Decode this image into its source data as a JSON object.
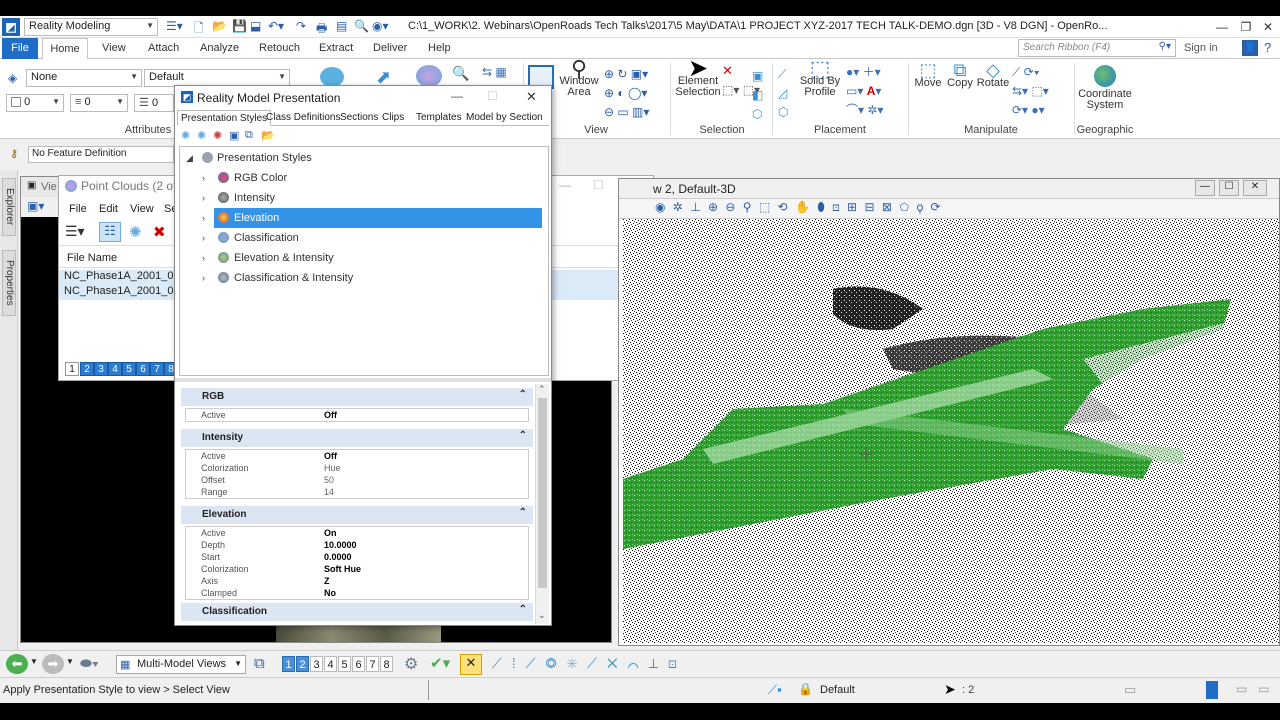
{
  "titlebar": {
    "workspace": "Reality Modeling",
    "title": "C:\\1_WORK\\2. Webinars\\OpenRoads Tech Talks\\2017\\5 May\\DATA\\1 PROJECT XYZ-2017 TECH TALK-DEMO.dgn [3D - V8 DGN] - OpenRo..."
  },
  "menu": {
    "file": "File",
    "tabs": [
      "Home",
      "View",
      "Attach",
      "Analyze",
      "Retouch",
      "Extract",
      "Deliver",
      "Help"
    ],
    "search_placeholder": "Search Ribbon (F4)",
    "sign_in": "Sign in"
  },
  "ribbon": {
    "level": "None",
    "style": "Default",
    "color": "0",
    "weight": "0",
    "linestyle": "0",
    "groups": {
      "attributes": "Attributes",
      "view": "View",
      "selection": "Selection",
      "placement": "Placement",
      "manipulate": "Manipulate",
      "geographic": "Geographic"
    },
    "buttons": {
      "window_area": "Window Area",
      "element_selection": "Element Selection",
      "solid_by_profile": "Solid By Profile",
      "move": "Move",
      "copy": "Copy",
      "rotate": "Rotate",
      "coordinate_system": "Coordinate System"
    }
  },
  "feature": {
    "definition": "No Feature Definition"
  },
  "sidetabs": [
    "Explorer",
    "Properties"
  ],
  "point_clouds": {
    "view_title": "Vie",
    "title": "Point Clouds (2 of",
    "menus": [
      "File",
      "Edit",
      "View",
      "Se"
    ],
    "column": "File Name",
    "files": [
      "NC_Phase1A_2001_00050",
      "NC_Phase1A_2001_00050"
    ],
    "pages": [
      "1",
      "2",
      "3",
      "4",
      "5",
      "6",
      "7",
      "8"
    ]
  },
  "right_view": {
    "title": "w 2, Default-3D"
  },
  "dialog": {
    "title": "Reality Model Presentation",
    "tabs": [
      "Presentation Styles",
      "Class Definitions",
      "Sections",
      "Clips",
      "Templates",
      "Model by Section"
    ],
    "tree_root": "Presentation Styles",
    "tree_items": [
      "RGB Color",
      "Intensity",
      "Elevation",
      "Classification",
      "Elevation & Intensity",
      "Classification & Intensity"
    ],
    "selected": "Elevation"
  },
  "props": {
    "rgb": {
      "title": "RGB",
      "rows": [
        {
          "label": "Active",
          "value": "Off"
        }
      ]
    },
    "intensity": {
      "title": "Intensity",
      "rows": [
        {
          "label": "Active",
          "value": "Off"
        },
        {
          "label": "Colorization",
          "value": "Hue"
        },
        {
          "label": "Offset",
          "value": "50"
        },
        {
          "label": "Range",
          "value": "14"
        }
      ]
    },
    "elevation": {
      "title": "Elevation",
      "rows": [
        {
          "label": "Active",
          "value": "On"
        },
        {
          "label": "Depth",
          "value": "10.0000"
        },
        {
          "label": "Start",
          "value": "0.0000"
        },
        {
          "label": "Colorization",
          "value": "Soft Hue"
        },
        {
          "label": "Axis",
          "value": "Z"
        },
        {
          "label": "Clamped",
          "value": "No"
        }
      ]
    },
    "classification": {
      "title": "Classification"
    }
  },
  "viewbar": {
    "views_combo": "Multi-Model Views",
    "view_numbers": [
      "1",
      "2",
      "3",
      "4",
      "5",
      "6",
      "7",
      "8"
    ]
  },
  "status": {
    "prompt": "Apply Presentation Style to view > Select View",
    "level": "Default",
    "count": ": 2"
  },
  "colors": {
    "accent": "#1e6ec8",
    "selection": "#3393e6",
    "section_header": "#dce6f2",
    "point_green": "#2e9e2e"
  }
}
